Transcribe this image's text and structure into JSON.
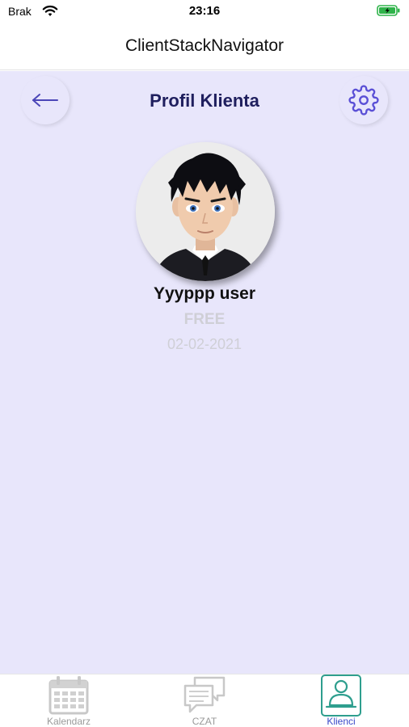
{
  "status_bar": {
    "carrier": "Brak",
    "time": "23:16"
  },
  "header": {
    "title": "ClientStackNavigator"
  },
  "screen": {
    "title": "Profil Klienta"
  },
  "client": {
    "name": "Yyyppp user",
    "plan": "FREE",
    "date": "02-02-2021"
  },
  "icons": {
    "back": "arrow-left-icon",
    "settings": "gear-icon",
    "calendar": "calendar-icon",
    "chat": "chat-icon",
    "clients": "person-icon"
  },
  "colors": {
    "background": "#e8e6fb",
    "accent": "#5a4fd6",
    "title": "#1f1f5e",
    "active_tab": "#3a4ac9",
    "active_border": "#2e9e8e"
  },
  "tabs": [
    {
      "label": "Kalendarz",
      "active": false
    },
    {
      "label": "CZAT",
      "active": false
    },
    {
      "label": "Klienci",
      "active": true
    }
  ]
}
